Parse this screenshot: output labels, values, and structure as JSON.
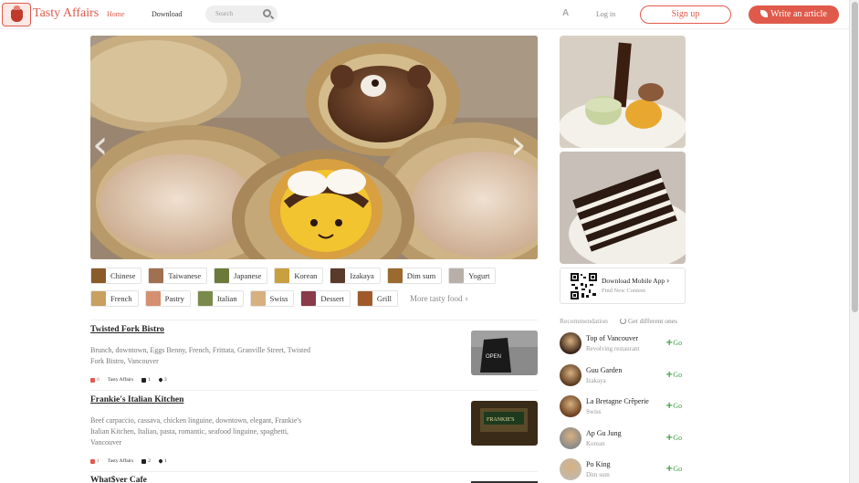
{
  "header": {
    "logo_text": "Tasty Affairs",
    "nav_home": "Home",
    "nav_download": "Download",
    "search_placeholder": "Search",
    "font_toggle": "A",
    "login": "Log in",
    "signup": "Sign up",
    "write_article": "Write an article"
  },
  "categories_row1": [
    {
      "label": "Chinese",
      "color": "#8b5a2b"
    },
    {
      "label": "Taiwanese",
      "color": "#a07050"
    },
    {
      "label": "Japanese",
      "color": "#6b7a3a"
    },
    {
      "label": "Korean",
      "color": "#c9a040"
    },
    {
      "label": "Izakaya",
      "color": "#5a3a2a"
    },
    {
      "label": "Dim sum",
      "color": "#9a6a30"
    },
    {
      "label": "Yogurt",
      "color": "#b8b0a8"
    }
  ],
  "categories_row2": [
    {
      "label": "French",
      "color": "#c8a060"
    },
    {
      "label": "Pastry",
      "color": "#d49070"
    },
    {
      "label": "Italian",
      "color": "#7a8a4a"
    },
    {
      "label": "Swiss",
      "color": "#d8b080"
    },
    {
      "label": "Dessert",
      "color": "#8a3a4a"
    },
    {
      "label": "Grill",
      "color": "#a05a2a"
    }
  ],
  "more_food": "More tasty food",
  "articles": [
    {
      "title": "Twisted Fork Bistro",
      "tags": "Brunch, downtown, Eggs Benny, French, Frittata, Granville Street, Twisted Fork Bistro, Vancouver",
      "downvotes": "0",
      "author": "Tasty Affairs",
      "comments": "1",
      "likes": "3",
      "image_text": "OPEN"
    },
    {
      "title": "Frankie's Italian Kitchen",
      "tags": "Beef carpaccio, cassava, chicken linguine, downtown, elegant, Frankie's Italian Kitchen, Italian, pasta, romantic, seafood linguine, spaghetti, Vancouver",
      "downvotes": "1",
      "author": "Tasty Affairs",
      "comments": "2",
      "likes": "1",
      "image_text": "FRANKIE'S"
    },
    {
      "title": "What$ver Cafe"
    }
  ],
  "app": {
    "title": "Download Mobile App",
    "subtitle": "Find New Content"
  },
  "recommendation": {
    "heading": "Recommendation",
    "change": "Get different ones",
    "go_label": "Go",
    "items": [
      {
        "name": "Top of Vancouver",
        "sub": "Revolving restaurant"
      },
      {
        "name": "Guu Garden",
        "sub": "Izakaya"
      },
      {
        "name": "La Bretagne Crêperie",
        "sub": "Swiss"
      },
      {
        "name": "Ap Gu Jung",
        "sub": "Korean"
      },
      {
        "name": "Po King",
        "sub": "Dim sum"
      }
    ]
  },
  "colors": {
    "accent": "#e05a4b",
    "go_green": "#3c9a3c"
  }
}
